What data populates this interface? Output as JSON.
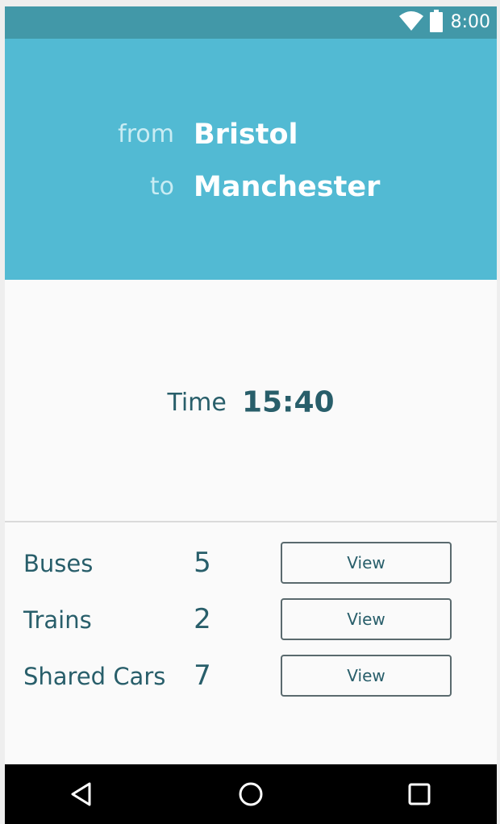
{
  "status_bar": {
    "time": "8:00",
    "icons": [
      "wifi-icon",
      "battery-icon"
    ],
    "background": "#4298a8"
  },
  "route": {
    "from_label": "from",
    "from_value": "Bristol",
    "to_label": "to",
    "to_value": "Manchester",
    "background": "#52bad3"
  },
  "time": {
    "label": "Time",
    "value": "15:40"
  },
  "options": [
    {
      "name": "Buses",
      "count": "5",
      "button_label": "View"
    },
    {
      "name": "Trains",
      "count": "2",
      "button_label": "View"
    },
    {
      "name": "Shared Cars",
      "count": "7",
      "button_label": "View"
    }
  ],
  "nav_bar": {
    "buttons": [
      "back-icon",
      "home-icon",
      "recents-icon"
    ]
  },
  "colors": {
    "accent_text": "#285e6a",
    "header_label": "#c9ecf3"
  }
}
